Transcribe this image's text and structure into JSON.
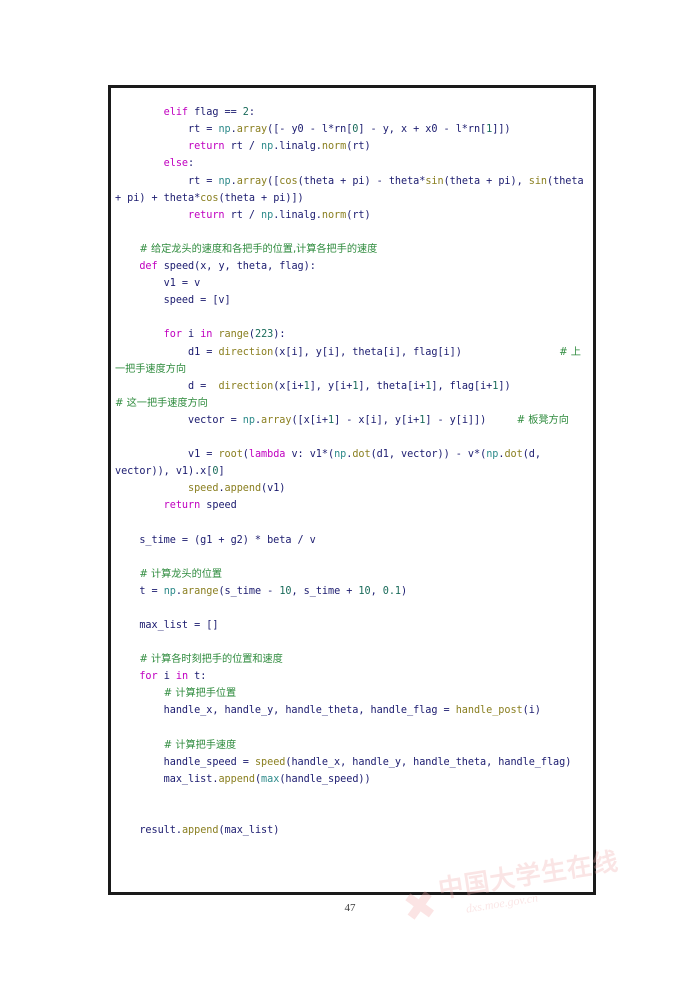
{
  "document": {
    "page_number": "47",
    "watermark": {
      "star_glyph": "✖",
      "chinese_text": "中国大学生在线",
      "url_text": "dxs.moe.gov.cn",
      "color": "#f0aaaa"
    },
    "colors": {
      "keyword": "#c000c0",
      "comment": "#2e8b3d",
      "module": "#2e8b8b",
      "function": "#8a7f20",
      "number": "#1a6b5a",
      "identifier": "#1b1b6f",
      "frame_border": "#1a1a1a",
      "page_background": "#ffffff"
    },
    "code_listing": {
      "language": "python",
      "lines": [
        "        elif flag == 2:",
        "            rt = np.array([- y0 - l*rn[0] - y, x + x0 - l*rn[1]])",
        "            return rt / np.linalg.norm(rt)",
        "        else:",
        "            rt = np.array([cos(theta + pi) - theta*sin(theta + pi), sin(theta + pi) + theta*cos(theta + pi)])",
        "            return rt / np.linalg.norm(rt)",
        "",
        "    # 给定龙头的速度和各把手的位置,计算各把手的速度",
        "    def speed(x, y, theta, flag):",
        "        v1 = v",
        "        speed = [v]",
        "",
        "        for i in range(223):",
        "            d1 = direction(x[i], y[i], theta[i], flag[i])                # 上一把手速度方向",
        "            d =  direction(x[i+1], y[i+1], theta[i+1], flag[i+1])             # 这一把手速度方向",
        "            vector = np.array([x[i+1] - x[i], y[i+1] - y[i]])     # 板凳方向",
        "",
        "            v1 = root(lambda v: v1*(np.dot(d1, vector)) - v*(np.dot(d, vector)), v1).x[0]",
        "            speed.append(v1)",
        "        return speed",
        "",
        "    s_time = (g1 + g2) * beta / v",
        "",
        "    # 计算龙头的位置",
        "    t = np.arange(s_time - 10, s_time + 10, 0.1)",
        "",
        "    max_list = []",
        "",
        "    # 计算各时刻把手的位置和速度",
        "    for i in t:",
        "        # 计算把手位置",
        "        handle_x, handle_y, handle_theta, handle_flag = handle_post(i)",
        "",
        "        # 计算把手速度",
        "        handle_speed = speed(handle_x, handle_y, handle_theta, handle_flag)",
        "        max_list.append(max(handle_speed))",
        "",
        "",
        "    result.append(max_list)"
      ],
      "comments": [
        "# 给定龙头的速度和各把手的位置,计算各把手的速度",
        "# 上一把手速度方向",
        "# 这一把手速度方向",
        "# 板凳方向",
        "# 计算龙头的位置",
        "# 计算各时刻把手的位置和速度",
        "# 计算把手位置",
        "# 计算把手速度"
      ],
      "keywords_used": [
        "elif",
        "else",
        "return",
        "def",
        "for",
        "in",
        "lambda"
      ],
      "functions_used": [
        "np.array",
        "np.linalg.norm",
        "cos",
        "sin",
        "direction",
        "root",
        "np.dot",
        "np.arange",
        "speed",
        "handle_post",
        "append",
        "max",
        "range"
      ],
      "numbers_used": [
        "2",
        "0",
        "1",
        "223",
        "10",
        "0.1"
      ]
    }
  }
}
